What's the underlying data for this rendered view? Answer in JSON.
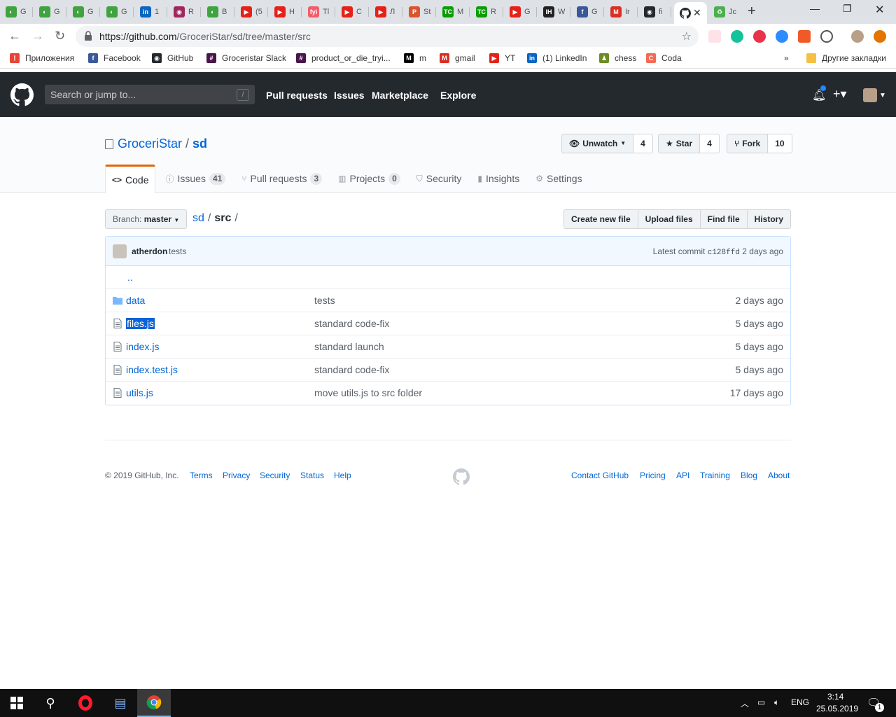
{
  "browser": {
    "tabs": [
      {
        "label": "G",
        "favicon_color": "#3fa33f",
        "glyph": "◐"
      },
      {
        "label": "G",
        "favicon_color": "#3fa33f",
        "glyph": "◐"
      },
      {
        "label": "G",
        "favicon_color": "#3fa33f",
        "glyph": "◐"
      },
      {
        "label": "G",
        "favicon_color": "#3fa33f",
        "glyph": "◐"
      },
      {
        "label": "1",
        "favicon_color": "#0a66c2",
        "glyph": "in"
      },
      {
        "label": "R",
        "favicon_color": "#a3245e",
        "glyph": "◉"
      },
      {
        "label": "B",
        "favicon_color": "#3fa33f",
        "glyph": "◐"
      },
      {
        "label": "(5",
        "favicon_color": "#e62117",
        "glyph": "▶"
      },
      {
        "label": "H",
        "favicon_color": "#e62117",
        "glyph": "▶"
      },
      {
        "label": "Tl",
        "favicon_color": "#f05d6b",
        "glyph": "fyi"
      },
      {
        "label": "C",
        "favicon_color": "#e62117",
        "glyph": "▶"
      },
      {
        "label": "Л",
        "favicon_color": "#e62117",
        "glyph": "▶"
      },
      {
        "label": "St",
        "favicon_color": "#da552f",
        "glyph": "P"
      },
      {
        "label": "M",
        "favicon_color": "#0a9e01",
        "glyph": "TC"
      },
      {
        "label": "R",
        "favicon_color": "#0a9e01",
        "glyph": "TC"
      },
      {
        "label": "G",
        "favicon_color": "#e62117",
        "glyph": "▶"
      },
      {
        "label": "W",
        "favicon_color": "#222222",
        "glyph": "IH"
      },
      {
        "label": "G",
        "favicon_color": "#3b5998",
        "glyph": "f"
      },
      {
        "label": "Ir",
        "favicon_color": "#d93025",
        "glyph": "M"
      },
      {
        "label": "fi",
        "favicon_color": "#24292e",
        "glyph": "◉"
      }
    ],
    "active_tab": {
      "favicon_color": "#24292e"
    },
    "last_tab": {
      "label": "Jc",
      "favicon_color": "#4caf50"
    },
    "url_host": "https://github.com",
    "url_path": "/GroceriStar/sd/tree/master/src",
    "bookmarks": [
      {
        "label": "Приложения",
        "color": "#ea4335",
        "glyph": "⋮"
      },
      {
        "label": "Facebook",
        "color": "#3b5998",
        "glyph": "f"
      },
      {
        "label": "GitHub",
        "color": "#24292e",
        "glyph": "◉"
      },
      {
        "label": "Groceristar Slack",
        "color": "#4a154b",
        "glyph": "#"
      },
      {
        "label": "product_or_die_tryi...",
        "color": "#4a154b",
        "glyph": "#"
      },
      {
        "label": "m",
        "color": "#000000",
        "glyph": "M"
      },
      {
        "label": "gmail",
        "color": "#d93025",
        "glyph": "M"
      },
      {
        "label": "YT",
        "color": "#e62117",
        "glyph": "▶"
      },
      {
        "label": "(1) LinkedIn",
        "color": "#0a66c2",
        "glyph": "in"
      },
      {
        "label": "chess",
        "color": "#6b8e23",
        "glyph": "♟"
      },
      {
        "label": "Coda",
        "color": "#f46a54",
        "glyph": "C"
      }
    ],
    "more_bookmarks": "»",
    "other_bookmarks": "Другие закладки"
  },
  "github": {
    "search_placeholder": "Search or jump to...",
    "search_key": "/",
    "nav": [
      "Pull requests",
      "Issues",
      "Marketplace",
      "Explore"
    ],
    "owner": "GroceriStar",
    "repo": "sd",
    "watch": {
      "label": "Unwatch",
      "count": "4"
    },
    "star": {
      "label": "Star",
      "count": "4"
    },
    "fork": {
      "label": "Fork",
      "count": "10"
    },
    "tabs": [
      {
        "label": "Code",
        "count": "",
        "icon": "<>"
      },
      {
        "label": "Issues",
        "count": "41",
        "icon": "ⓘ"
      },
      {
        "label": "Pull requests",
        "count": "3",
        "icon": "⑂"
      },
      {
        "label": "Projects",
        "count": "0",
        "icon": "▥"
      },
      {
        "label": "Security",
        "count": "",
        "icon": "⛉"
      },
      {
        "label": "Insights",
        "count": "",
        "icon": "▮"
      },
      {
        "label": "Settings",
        "count": "",
        "icon": "⚙"
      }
    ],
    "branch_label": "Branch:",
    "branch": "master",
    "crumb_root": "sd",
    "crumb_dir": "src",
    "file_buttons": [
      "Create new file",
      "Upload files",
      "Find file",
      "History"
    ],
    "commit": {
      "author": "atherdon",
      "message": "tests",
      "latest_label": "Latest commit",
      "sha": "c128ffd",
      "age": "2 days ago"
    },
    "parent_dir": "..",
    "files": [
      {
        "name": "data",
        "type": "dir",
        "message": "tests",
        "age": "2 days ago"
      },
      {
        "name": "files.js",
        "type": "file",
        "message": "standard code-fix",
        "age": "5 days ago",
        "selected": true
      },
      {
        "name": "index.js",
        "type": "file",
        "message": "standard launch",
        "age": "5 days ago"
      },
      {
        "name": "index.test.js",
        "type": "file",
        "message": "standard code-fix",
        "age": "5 days ago"
      },
      {
        "name": "utils.js",
        "type": "file",
        "message": "move utils.js to src folder",
        "age": "17 days ago"
      }
    ],
    "footer_left": [
      "© 2019 GitHub, Inc.",
      "Terms",
      "Privacy",
      "Security",
      "Status",
      "Help"
    ],
    "footer_right": [
      "Contact GitHub",
      "Pricing",
      "API",
      "Training",
      "Blog",
      "About"
    ]
  },
  "taskbar": {
    "language": "ENG",
    "time": "3:14",
    "date": "25.05.2019",
    "notifications": "1"
  },
  "colors": {
    "link": "#0366d6",
    "header": "#24292e",
    "tab_accent": "#e36209",
    "selection": "#0a63d8"
  }
}
